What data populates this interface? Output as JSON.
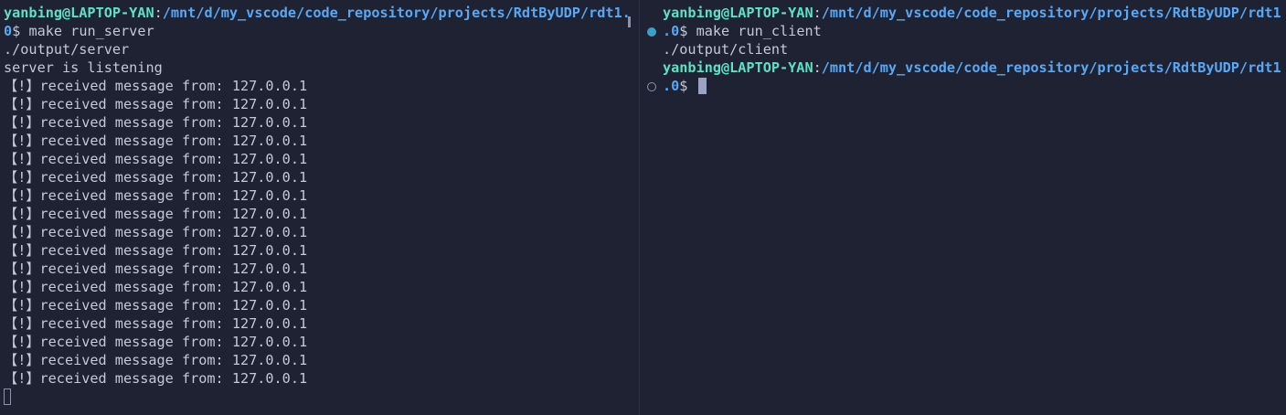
{
  "left_terminal": {
    "prompt": {
      "user_host": "yanbing@LAPTOP-YAN",
      "colon": ":",
      "path_part1": "/mnt/d/my_vscode/code_repository/projects/RdtByUDP/rdt1.",
      "path_part2": "0",
      "dollar": "$ "
    },
    "command": "make run_server",
    "output": [
      "./output/server",
      "server is listening"
    ],
    "messages": [
      "【!】received message from: 127.0.0.1",
      "【!】received message from: 127.0.0.1",
      "【!】received message from: 127.0.0.1",
      "【!】received message from: 127.0.0.1",
      "【!】received message from: 127.0.0.1",
      "【!】received message from: 127.0.0.1",
      "【!】received message from: 127.0.0.1",
      "【!】received message from: 127.0.0.1",
      "【!】received message from: 127.0.0.1",
      "【!】received message from: 127.0.0.1",
      "【!】received message from: 127.0.0.1",
      "【!】received message from: 127.0.0.1",
      "【!】received message from: 127.0.0.1",
      "【!】received message from: 127.0.0.1",
      "【!】received message from: 127.0.0.1",
      "【!】received message from: 127.0.0.1",
      "【!】received message from: 127.0.0.1"
    ]
  },
  "right_terminal": {
    "prompt": {
      "user_host": "yanbing@LAPTOP-YAN",
      "colon": ":",
      "path_part1": "/mnt/d/my_vscode/code_repository/projects/RdtByUDP/rdt1",
      "path_part2": ".0",
      "dollar": "$ "
    },
    "command": "make run_client",
    "output": [
      "./output/client"
    ]
  },
  "colors": {
    "background": "#1f2233",
    "user_host": "#5fe0c5",
    "path": "#58a8f5",
    "text": "#c5c8d6",
    "decoration_success": "#3aa0c8"
  }
}
